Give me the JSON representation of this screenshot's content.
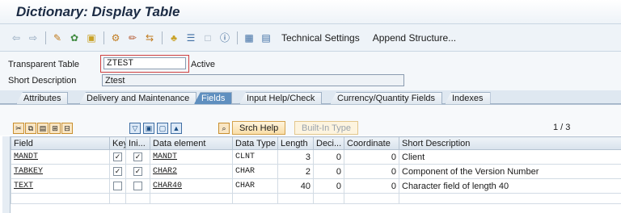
{
  "window": {
    "title": "Dictionary: Display Table"
  },
  "toolbar": {
    "icons": [
      "back-arrow-icon",
      "forward-arrow-icon",
      "other-object-icon",
      "display-change-icon",
      "activate-icon",
      "where-used-icon",
      "object-list-icon",
      "edit-icon",
      "navigation-icon",
      "hierarchy-icon",
      "display-object-list-icon",
      "blank-icon",
      "info-icon",
      "index-icon",
      "contents-icon"
    ],
    "technical_settings": "Technical Settings",
    "append_structure": "Append Structure..."
  },
  "header": {
    "transparent_table_label": "Transparent Table",
    "table_name": "ZTEST",
    "status": "Active",
    "short_description_label": "Short Description",
    "short_description": "Ztest"
  },
  "tabs": [
    {
      "label": "Attributes",
      "active": false
    },
    {
      "label": "Delivery and Maintenance",
      "active": false
    },
    {
      "label": "Fields",
      "active": true
    },
    {
      "label": "Input Help/Check",
      "active": false
    },
    {
      "label": "Currency/Quantity Fields",
      "active": false
    },
    {
      "label": "Indexes",
      "active": false
    }
  ],
  "fields_tab": {
    "srch_help_button": "Srch Help",
    "builtin_type_button": "Built-In Type",
    "pager": "1 / 3",
    "columns": [
      "Field",
      "Key",
      "Ini...",
      "Data element",
      "Data Type",
      "Length",
      "Deci...",
      "Coordinate",
      "Short Description"
    ],
    "rows": [
      {
        "field": "MANDT",
        "key": true,
        "initial": true,
        "data_element": "MANDT",
        "data_type": "CLNT",
        "length": "3",
        "decimals": "0",
        "coordinate": "0",
        "short_description": "Client"
      },
      {
        "field": "TABKEY",
        "key": true,
        "initial": true,
        "data_element": "CHAR2",
        "data_type": "CHAR",
        "length": "2",
        "decimals": "0",
        "coordinate": "0",
        "short_description": "Component of the Version Number"
      },
      {
        "field": "TEXT",
        "key": false,
        "initial": false,
        "data_element": "CHAR40",
        "data_type": "CHAR",
        "length": "40",
        "decimals": "0",
        "coordinate": "0",
        "short_description": "Character field of length 40"
      }
    ]
  },
  "colors": {
    "active_tab": "#5f8fbf",
    "button_border": "#d4a24c",
    "focus_frame": "#d04040"
  }
}
